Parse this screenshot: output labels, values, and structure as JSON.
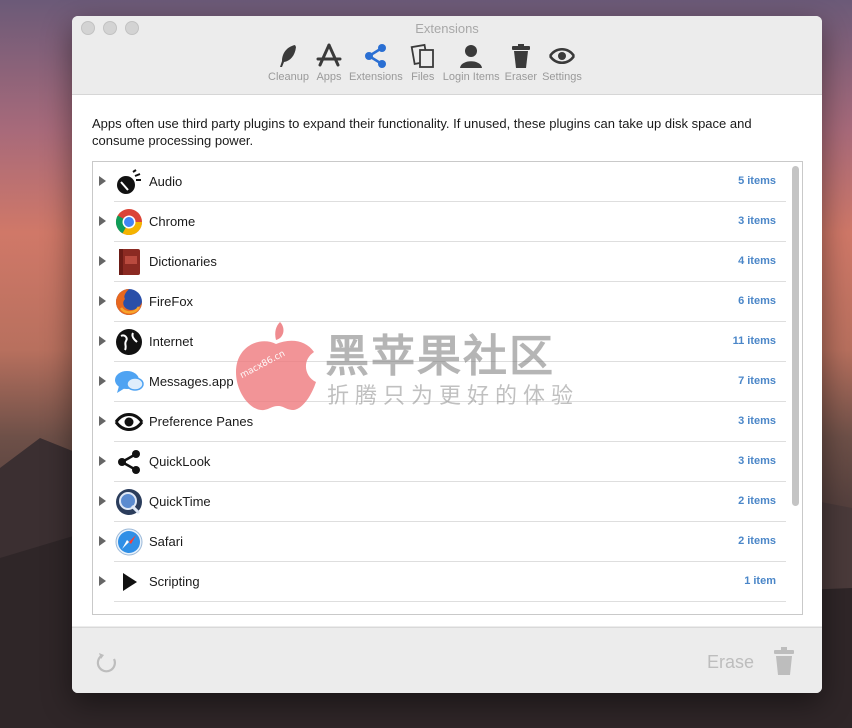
{
  "window": {
    "title": "Extensions"
  },
  "toolbar": {
    "items": [
      {
        "label": "Cleanup",
        "icon": "feather-icon"
      },
      {
        "label": "Apps",
        "icon": "apps-icon"
      },
      {
        "label": "Extensions",
        "icon": "share-icon",
        "active": true
      },
      {
        "label": "Files",
        "icon": "files-icon"
      },
      {
        "label": "Login Items",
        "icon": "user-icon"
      },
      {
        "label": "Eraser",
        "icon": "trash-icon"
      },
      {
        "label": "Settings",
        "icon": "eye-icon"
      }
    ]
  },
  "description": "Apps often use third party plugins to expand their functionality. If unused, these plugins can take up disk space and consume processing power.",
  "list": {
    "rows": [
      {
        "name": "Audio",
        "count": "5 items",
        "icon": "audio-icon"
      },
      {
        "name": "Chrome",
        "count": "3 items",
        "icon": "chrome-icon"
      },
      {
        "name": "Dictionaries",
        "count": "4 items",
        "icon": "dictionary-icon"
      },
      {
        "name": "FireFox",
        "count": "6 items",
        "icon": "firefox-icon"
      },
      {
        "name": "Internet",
        "count": "11 items",
        "icon": "internet-icon"
      },
      {
        "name": "Messages.app",
        "count": "7 items",
        "icon": "messages-icon"
      },
      {
        "name": "Preference Panes",
        "count": "3 items",
        "icon": "preference-panes-icon"
      },
      {
        "name": "QuickLook",
        "count": "3 items",
        "icon": "quicklook-icon"
      },
      {
        "name": "QuickTime",
        "count": "2 items",
        "icon": "quicktime-icon"
      },
      {
        "name": "Safari",
        "count": "2 items",
        "icon": "safari-icon"
      },
      {
        "name": "Scripting",
        "count": "1 item",
        "icon": "scripting-icon"
      }
    ]
  },
  "footer": {
    "erase_label": "Erase"
  },
  "watermark": {
    "title": "黑苹果社区",
    "subtitle": "折腾只为更好的体验",
    "url": "macx86.cn"
  },
  "colors": {
    "accent": "#4a86c8",
    "count_text": "#4a86c8"
  }
}
